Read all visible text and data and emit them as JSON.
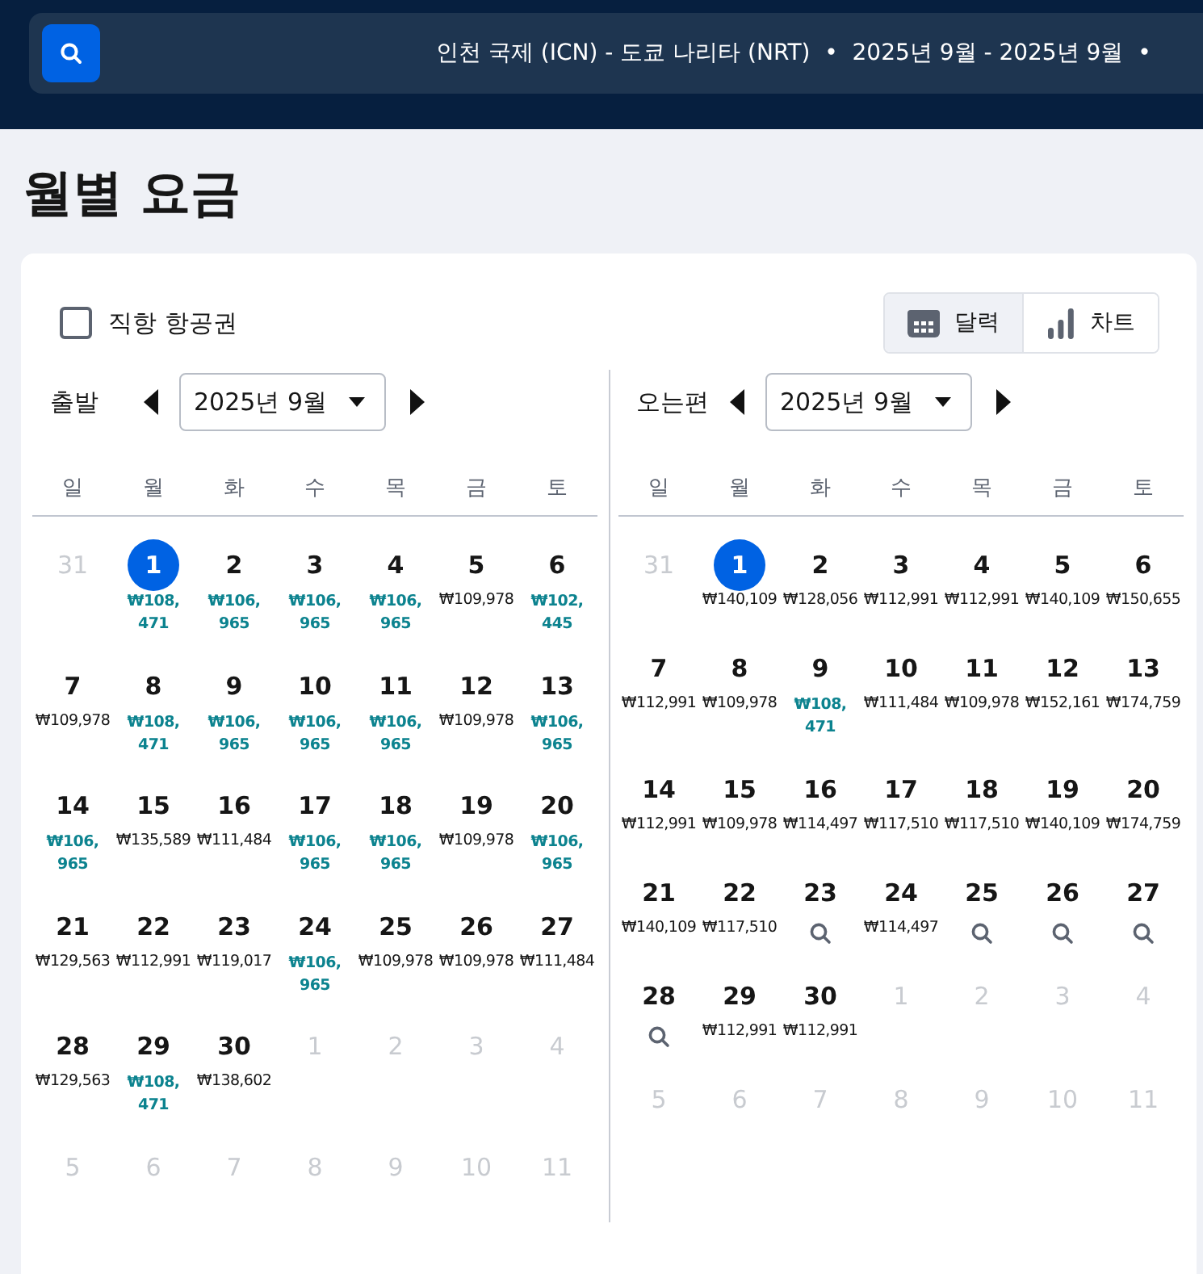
{
  "search_bar": {
    "summary": "인천 국제 (ICN) - 도쿄 나리타 (NRT)  •  2025년 9월 - 2025년 9월  •"
  },
  "title": "월별 요금",
  "direct_filter": {
    "label": "직항 항공권",
    "checked": false
  },
  "view_toggle": [
    {
      "label": "달력",
      "kind": "calendar",
      "selected": true
    },
    {
      "label": "차트",
      "kind": "chart",
      "selected": false
    }
  ],
  "calendars": [
    {
      "label": "출발",
      "month": "2025년 9월",
      "weekdays": [
        "일",
        "월",
        "화",
        "수",
        "목",
        "금",
        "토"
      ],
      "weeks": [
        [
          {
            "day": "31",
            "muted": true,
            "selected": false,
            "kind": "empty"
          },
          {
            "day": "1",
            "muted": false,
            "selected": true,
            "kind": "price",
            "price": "₩108,471",
            "low": true
          },
          {
            "day": "2",
            "muted": false,
            "selected": false,
            "kind": "price",
            "price": "₩106,965",
            "low": true
          },
          {
            "day": "3",
            "muted": false,
            "selected": false,
            "kind": "price",
            "price": "₩106,965",
            "low": true
          },
          {
            "day": "4",
            "muted": false,
            "selected": false,
            "kind": "price",
            "price": "₩106,965",
            "low": true
          },
          {
            "day": "5",
            "muted": false,
            "selected": false,
            "kind": "price",
            "price": "₩109,978",
            "low": false
          },
          {
            "day": "6",
            "muted": false,
            "selected": false,
            "kind": "price",
            "price": "₩102,445",
            "low": true
          }
        ],
        [
          {
            "day": "7",
            "muted": false,
            "selected": false,
            "kind": "price",
            "price": "₩109,978",
            "low": false
          },
          {
            "day": "8",
            "muted": false,
            "selected": false,
            "kind": "price",
            "price": "₩108,471",
            "low": true
          },
          {
            "day": "9",
            "muted": false,
            "selected": false,
            "kind": "price",
            "price": "₩106,965",
            "low": true
          },
          {
            "day": "10",
            "muted": false,
            "selected": false,
            "kind": "price",
            "price": "₩106,965",
            "low": true
          },
          {
            "day": "11",
            "muted": false,
            "selected": false,
            "kind": "price",
            "price": "₩106,965",
            "low": true
          },
          {
            "day": "12",
            "muted": false,
            "selected": false,
            "kind": "price",
            "price": "₩109,978",
            "low": false
          },
          {
            "day": "13",
            "muted": false,
            "selected": false,
            "kind": "price",
            "price": "₩106,965",
            "low": true
          }
        ],
        [
          {
            "day": "14",
            "muted": false,
            "selected": false,
            "kind": "price",
            "price": "₩106,965",
            "low": true
          },
          {
            "day": "15",
            "muted": false,
            "selected": false,
            "kind": "price",
            "price": "₩135,589",
            "low": false
          },
          {
            "day": "16",
            "muted": false,
            "selected": false,
            "kind": "price",
            "price": "₩111,484",
            "low": false
          },
          {
            "day": "17",
            "muted": false,
            "selected": false,
            "kind": "price",
            "price": "₩106,965",
            "low": true
          },
          {
            "day": "18",
            "muted": false,
            "selected": false,
            "kind": "price",
            "price": "₩106,965",
            "low": true
          },
          {
            "day": "19",
            "muted": false,
            "selected": false,
            "kind": "price",
            "price": "₩109,978",
            "low": false
          },
          {
            "day": "20",
            "muted": false,
            "selected": false,
            "kind": "price",
            "price": "₩106,965",
            "low": true
          }
        ],
        [
          {
            "day": "21",
            "muted": false,
            "selected": false,
            "kind": "price",
            "price": "₩129,563",
            "low": false
          },
          {
            "day": "22",
            "muted": false,
            "selected": false,
            "kind": "price",
            "price": "₩112,991",
            "low": false
          },
          {
            "day": "23",
            "muted": false,
            "selected": false,
            "kind": "price",
            "price": "₩119,017",
            "low": false
          },
          {
            "day": "24",
            "muted": false,
            "selected": false,
            "kind": "price",
            "price": "₩106,965",
            "low": true
          },
          {
            "day": "25",
            "muted": false,
            "selected": false,
            "kind": "price",
            "price": "₩109,978",
            "low": false
          },
          {
            "day": "26",
            "muted": false,
            "selected": false,
            "kind": "price",
            "price": "₩109,978",
            "low": false
          },
          {
            "day": "27",
            "muted": false,
            "selected": false,
            "kind": "price",
            "price": "₩111,484",
            "low": false
          }
        ],
        [
          {
            "day": "28",
            "muted": false,
            "selected": false,
            "kind": "price",
            "price": "₩129,563",
            "low": false
          },
          {
            "day": "29",
            "muted": false,
            "selected": false,
            "kind": "price",
            "price": "₩108,471",
            "low": true
          },
          {
            "day": "30",
            "muted": false,
            "selected": false,
            "kind": "price",
            "price": "₩138,602",
            "low": false
          },
          {
            "day": "1",
            "muted": true,
            "selected": false,
            "kind": "empty"
          },
          {
            "day": "2",
            "muted": true,
            "selected": false,
            "kind": "empty"
          },
          {
            "day": "3",
            "muted": true,
            "selected": false,
            "kind": "empty"
          },
          {
            "day": "4",
            "muted": true,
            "selected": false,
            "kind": "empty"
          }
        ],
        [
          {
            "day": "5",
            "muted": true,
            "selected": false,
            "kind": "empty"
          },
          {
            "day": "6",
            "muted": true,
            "selected": false,
            "kind": "empty"
          },
          {
            "day": "7",
            "muted": true,
            "selected": false,
            "kind": "empty"
          },
          {
            "day": "8",
            "muted": true,
            "selected": false,
            "kind": "empty"
          },
          {
            "day": "9",
            "muted": true,
            "selected": false,
            "kind": "empty"
          },
          {
            "day": "10",
            "muted": true,
            "selected": false,
            "kind": "empty"
          },
          {
            "day": "11",
            "muted": true,
            "selected": false,
            "kind": "empty"
          }
        ]
      ]
    },
    {
      "label": "오는편",
      "month": "2025년 9월",
      "weekdays": [
        "일",
        "월",
        "화",
        "수",
        "목",
        "금",
        "토"
      ],
      "weeks": [
        [
          {
            "day": "31",
            "muted": true,
            "selected": false,
            "kind": "empty"
          },
          {
            "day": "1",
            "muted": false,
            "selected": true,
            "kind": "price",
            "price": "₩140,109",
            "low": false
          },
          {
            "day": "2",
            "muted": false,
            "selected": false,
            "kind": "price",
            "price": "₩128,056",
            "low": false
          },
          {
            "day": "3",
            "muted": false,
            "selected": false,
            "kind": "price",
            "price": "₩112,991",
            "low": false
          },
          {
            "day": "4",
            "muted": false,
            "selected": false,
            "kind": "price",
            "price": "₩112,991",
            "low": false
          },
          {
            "day": "5",
            "muted": false,
            "selected": false,
            "kind": "price",
            "price": "₩140,109",
            "low": false
          },
          {
            "day": "6",
            "muted": false,
            "selected": false,
            "kind": "price",
            "price": "₩150,655",
            "low": false
          }
        ],
        [
          {
            "day": "7",
            "muted": false,
            "selected": false,
            "kind": "price",
            "price": "₩112,991",
            "low": false
          },
          {
            "day": "8",
            "muted": false,
            "selected": false,
            "kind": "price",
            "price": "₩109,978",
            "low": false
          },
          {
            "day": "9",
            "muted": false,
            "selected": false,
            "kind": "price",
            "price": "₩108,471",
            "low": true
          },
          {
            "day": "10",
            "muted": false,
            "selected": false,
            "kind": "price",
            "price": "₩111,484",
            "low": false
          },
          {
            "day": "11",
            "muted": false,
            "selected": false,
            "kind": "price",
            "price": "₩109,978",
            "low": false
          },
          {
            "day": "12",
            "muted": false,
            "selected": false,
            "kind": "price",
            "price": "₩152,161",
            "low": false
          },
          {
            "day": "13",
            "muted": false,
            "selected": false,
            "kind": "price",
            "price": "₩174,759",
            "low": false
          }
        ],
        [
          {
            "day": "14",
            "muted": false,
            "selected": false,
            "kind": "price",
            "price": "₩112,991",
            "low": false
          },
          {
            "day": "15",
            "muted": false,
            "selected": false,
            "kind": "price",
            "price": "₩109,978",
            "low": false
          },
          {
            "day": "16",
            "muted": false,
            "selected": false,
            "kind": "price",
            "price": "₩114,497",
            "low": false
          },
          {
            "day": "17",
            "muted": false,
            "selected": false,
            "kind": "price",
            "price": "₩117,510",
            "low": false
          },
          {
            "day": "18",
            "muted": false,
            "selected": false,
            "kind": "price",
            "price": "₩117,510",
            "low": false
          },
          {
            "day": "19",
            "muted": false,
            "selected": false,
            "kind": "price",
            "price": "₩140,109",
            "low": false
          },
          {
            "day": "20",
            "muted": false,
            "selected": false,
            "kind": "price",
            "price": "₩174,759",
            "low": false
          }
        ],
        [
          {
            "day": "21",
            "muted": false,
            "selected": false,
            "kind": "price",
            "price": "₩140,109",
            "low": false
          },
          {
            "day": "22",
            "muted": false,
            "selected": false,
            "kind": "price",
            "price": "₩117,510",
            "low": false
          },
          {
            "day": "23",
            "muted": false,
            "selected": false,
            "kind": "search"
          },
          {
            "day": "24",
            "muted": false,
            "selected": false,
            "kind": "price",
            "price": "₩114,497",
            "low": false
          },
          {
            "day": "25",
            "muted": false,
            "selected": false,
            "kind": "search"
          },
          {
            "day": "26",
            "muted": false,
            "selected": false,
            "kind": "search"
          },
          {
            "day": "27",
            "muted": false,
            "selected": false,
            "kind": "search"
          }
        ],
        [
          {
            "day": "28",
            "muted": false,
            "selected": false,
            "kind": "search"
          },
          {
            "day": "29",
            "muted": false,
            "selected": false,
            "kind": "price",
            "price": "₩112,991",
            "low": false
          },
          {
            "day": "30",
            "muted": false,
            "selected": false,
            "kind": "price",
            "price": "₩112,991",
            "low": false
          },
          {
            "day": "1",
            "muted": true,
            "selected": false,
            "kind": "empty"
          },
          {
            "day": "2",
            "muted": true,
            "selected": false,
            "kind": "empty"
          },
          {
            "day": "3",
            "muted": true,
            "selected": false,
            "kind": "empty"
          },
          {
            "day": "4",
            "muted": true,
            "selected": false,
            "kind": "empty"
          }
        ],
        [
          {
            "day": "5",
            "muted": true,
            "selected": false,
            "kind": "empty"
          },
          {
            "day": "6",
            "muted": true,
            "selected": false,
            "kind": "empty"
          },
          {
            "day": "7",
            "muted": true,
            "selected": false,
            "kind": "empty"
          },
          {
            "day": "8",
            "muted": true,
            "selected": false,
            "kind": "empty"
          },
          {
            "day": "9",
            "muted": true,
            "selected": false,
            "kind": "empty"
          },
          {
            "day": "10",
            "muted": true,
            "selected": false,
            "kind": "empty"
          },
          {
            "day": "11",
            "muted": true,
            "selected": false,
            "kind": "empty"
          }
        ]
      ]
    }
  ]
}
